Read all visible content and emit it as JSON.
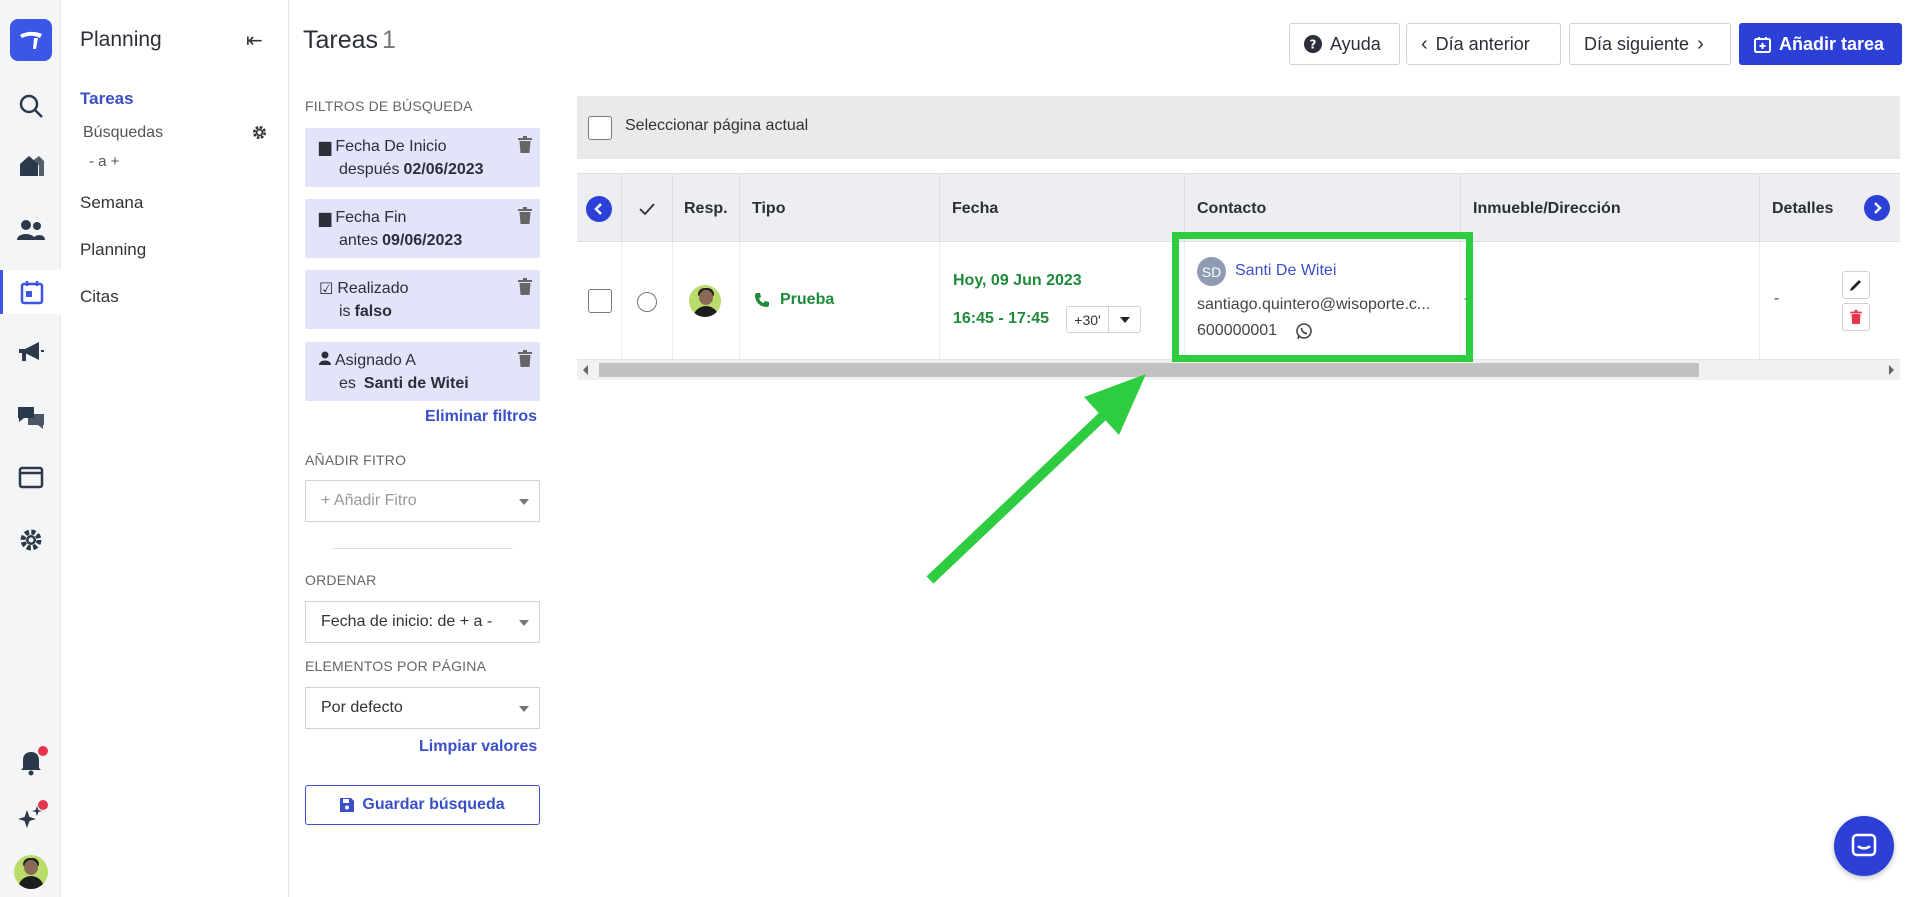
{
  "nav": {
    "title": "Planning",
    "items": [
      {
        "label": "Tareas"
      },
      {
        "label": "Semana"
      },
      {
        "label": "Planning"
      },
      {
        "label": "Citas"
      }
    ],
    "searches_label": "Búsquedas",
    "order_label": "- a +"
  },
  "filters": {
    "section_title": "FILTROS DE BÚSQUEDA",
    "cards": [
      {
        "title": "Fecha De Inicio",
        "op": "después",
        "value": "02/06/2023",
        "icon": "calendar-icon"
      },
      {
        "title": "Fecha Fin",
        "op": "antes",
        "value": "09/06/2023",
        "icon": "calendar-icon"
      },
      {
        "title": "Realizado",
        "op": "is",
        "value": "falso",
        "icon": "check-square-icon"
      },
      {
        "title": "Asignado A",
        "op": "es",
        "value": "Santi de Witei",
        "icon": "user-icon"
      }
    ],
    "clear_filters": "Eliminar filtros",
    "add_filter_title": "AÑADIR FITRO",
    "add_filter_placeholder": "+ Añadir Fitro",
    "sort_title": "ORDENAR",
    "sort_value": "Fecha de inicio: de + a -",
    "per_page_title": "ELEMENTOS POR PÁGINA",
    "per_page_value": "Por defecto",
    "clear_values": "Limpiar valores",
    "save_search": "Guardar búsqueda"
  },
  "header": {
    "title": "Tareas",
    "count": "1",
    "help": "Ayuda",
    "prev_day": "Día anterior",
    "next_day": "Día siguiente",
    "add_task": "Añadir tarea"
  },
  "table": {
    "select_page": "Seleccionar página actual",
    "columns": [
      "Resp.",
      "Tipo",
      "Fecha",
      "Contacto",
      "Inmueble/Dirección",
      "Detalles"
    ],
    "rows": [
      {
        "type": "Prueba",
        "date": "Hoy, 09 Jun 2023",
        "time": "16:45 - 17:45",
        "postpone": "+30'",
        "contact_initials": "SD",
        "contact_name": "Santi De Witei",
        "contact_email": "santiago.quintero@wisoporte.c...",
        "contact_phone": "600000001",
        "address": "-",
        "details": "-"
      }
    ]
  },
  "colors": {
    "accent": "#2c40d8",
    "highlight": "#2ecc40",
    "type_green": "#1e8a3a",
    "filter_bg": "#e2e5f9"
  }
}
